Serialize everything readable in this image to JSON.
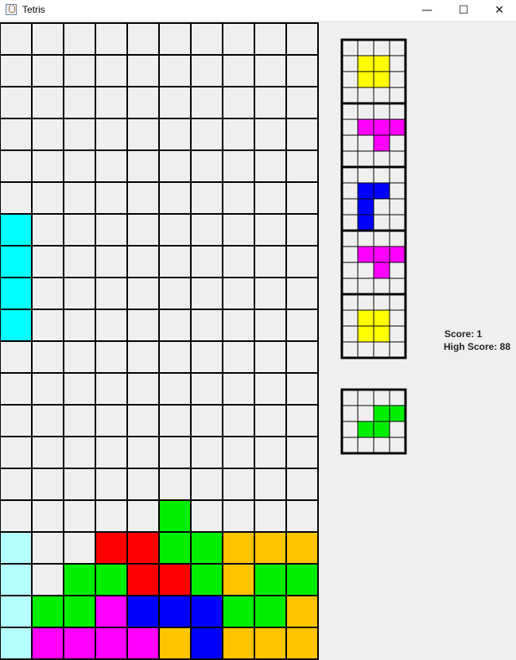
{
  "window": {
    "title": "Tetris",
    "controls": {
      "minimize": "—",
      "maximize": "☐",
      "close": "✕"
    }
  },
  "colors": {
    "empty": "#efefef",
    "grid_line": "#000000",
    "I": "#00ffff",
    "I_light": "#b4ffff",
    "O": "#ffff00",
    "T": "#ff00ff",
    "J": "#0000ff",
    "L": "#ffc400",
    "S": "#00ee00",
    "Z": "#ff0000"
  },
  "board": {
    "columns": 10,
    "rows": 20,
    "cells": [
      "..........",
      "..........",
      "..........",
      "..........",
      "..........",
      "..........",
      "I.........",
      "I.........",
      "I.........",
      "I.........",
      "..........",
      "..........",
      "..........",
      "..........",
      "..........",
      ".....S....",
      "i..ZZSSLLL",
      "i.SSZZSLSS",
      "iSSTJJJSSL",
      "iTTTTLJLLL"
    ]
  },
  "next_queue": [
    {
      "piece": "O",
      "cells": [
        "....",
        ".OO.",
        ".OO.",
        "...."
      ]
    },
    {
      "piece": "T",
      "cells": [
        "....",
        ".TTT",
        "..T.",
        "...."
      ]
    },
    {
      "piece": "J",
      "cells": [
        "....",
        ".JJ.",
        ".J..",
        ".J.."
      ]
    },
    {
      "piece": "T",
      "cells": [
        "....",
        ".TTT",
        "..T.",
        "...."
      ]
    },
    {
      "piece": "O",
      "cells": [
        "....",
        ".OO.",
        ".OO.",
        "...."
      ]
    }
  ],
  "hold": {
    "piece": "S",
    "cells": [
      "....",
      "..SS",
      ".SS.",
      "...."
    ]
  },
  "score": {
    "score_text": "Score: 1",
    "high_score_text": "High Score: 88"
  }
}
